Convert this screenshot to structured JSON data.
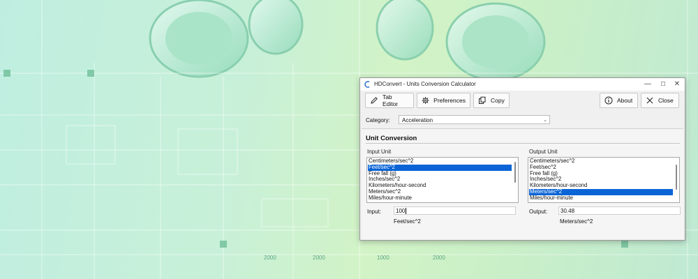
{
  "window": {
    "title": "HDConvert - Units Conversion Calculator",
    "controls": {
      "minimize": "—",
      "maximize": "☐",
      "close": "✕"
    }
  },
  "toolbar": {
    "tab_editor_label": "Tab Editor",
    "preferences_label": "Preferences",
    "copy_label": "Copy",
    "about_label": "About",
    "close_label": "Close"
  },
  "category": {
    "label": "Category:",
    "value": "Acceleration"
  },
  "panel": {
    "title": "Unit Conversion",
    "input_unit_label": "Input Unit",
    "output_unit_label": "Output Unit"
  },
  "input_list": {
    "items": [
      "Centimeters/sec^2",
      "Feet/sec^2",
      "Free fall (g)",
      "Inches/sec^2",
      "Kilometers/hour-second",
      "Meters/sec^2",
      "Miles/hour-minute"
    ],
    "selected_index": 1
  },
  "output_list": {
    "items": [
      "Centimeters/sec^2",
      "Feet/sec^2",
      "Free fall (g)",
      "Inches/sec^2",
      "Kilometers/hour-second",
      "Meters/sec^2",
      "Miles/hour-minute"
    ],
    "selected_index": 5
  },
  "input": {
    "label": "Input:",
    "value": "100",
    "unit": "Feet/sec^2"
  },
  "output": {
    "label": "Output:",
    "value": "30.48",
    "unit": "Meters/sec^2"
  },
  "background_blueprint_labels": [
    "2000",
    "2000",
    "1000",
    "2000"
  ],
  "colors": {
    "selection": "#0a64d6",
    "window_bg": "#f0f0f0",
    "background_tint": "#c8f0d8"
  },
  "icons": {
    "tab_editor": "pencil-icon",
    "preferences": "gear-icon",
    "copy": "copy-icon",
    "about": "info-icon",
    "close": "close-x-icon",
    "app": "app-logo-icon"
  }
}
